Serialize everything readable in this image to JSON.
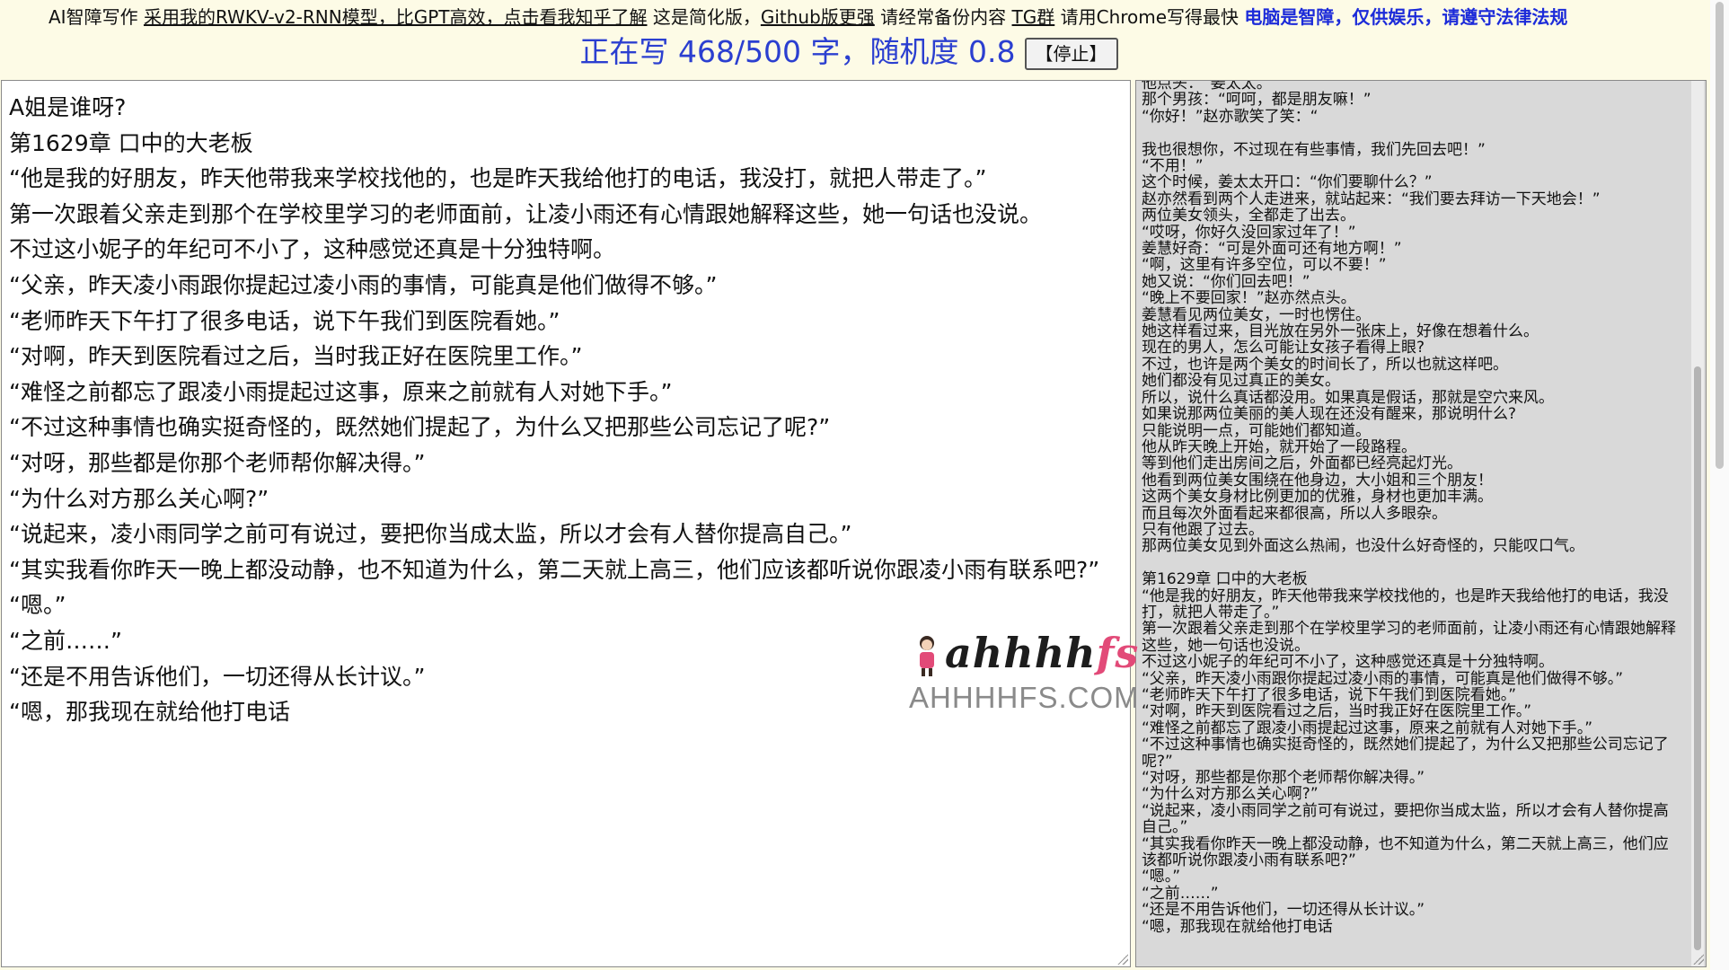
{
  "header": {
    "app_name": "AI智障写作",
    "model_link": "采用我的RWKV-v2-RNN模型，比GPT高效，点击看我知乎了解",
    "simplified_note": "这是简化版，",
    "github_link": "Github版更强",
    "backup_note": "请经常备份内容",
    "tg_link": "TG群",
    "chrome_note": "请用Chrome写得最快",
    "warning": "电脑是智障，仅供娱乐，请遵守法律法规",
    "status": "正在写 468/500 字，随机度 0.8",
    "stop_button": "【停止】",
    "colors": {
      "warning": "#1c2bd9",
      "status": "#2b3fd0"
    }
  },
  "editor": {
    "paragraphs": [
      "A姐是谁呀?",
      "第1629章 口中的大老板",
      "“他是我的好朋友，昨天他带我来学校找他的，也是昨天我给他打的电话，我没打，就把人带走了。”",
      "第一次跟着父亲走到那个在学校里学习的老师面前，让凌小雨还有心情跟她解释这些，她一句话也没说。",
      "不过这小妮子的年纪可不小了，这种感觉还真是十分独特啊。",
      "“父亲，昨天凌小雨跟你提起过凌小雨的事情，可能真是他们做得不够。”",
      "“老师昨天下午打了很多电话，说下午我们到医院看她。”",
      "“对啊，昨天到医院看过之后，当时我正好在医院里工作。”",
      "“难怪之前都忘了跟凌小雨提起过这事，原来之前就有人对她下手。”",
      "“不过这种事情也确实挺奇怪的，既然她们提起了，为什么又把那些公司忘记了呢?”",
      "“对呀，那些都是你那个老师帮你解决得。”",
      "“为什么对方那么关心啊?”",
      "“说起来，凌小雨同学之前可有说过，要把你当成太监，所以才会有人替你提高自己。”",
      "“其实我看你昨天一晚上都没动静，也不知道为什么，第二天就上高三，他们应该都听说你跟凌小雨有联系吧?”",
      "“嗯。”",
      "“之前……”",
      "“还是不用告诉他们，一切还得从长计议。”",
      "“嗯，那我现在就给他打电话"
    ]
  },
  "side": {
    "lines": [
      "他点头：“姜太太。”",
      "那个男孩：“呵呵，都是朋友嘛！”",
      "“你好！”赵亦歌笑了笑：“",
      "",
      "我也很想你，不过现在有些事情，我们先回去吧！”",
      "“不用！”",
      "这个时候，姜太太开口：“你们要聊什么？”",
      "赵亦然看到两个人走进来，就站起来：“我们要去拜访一下天地会！”",
      "两位美女领头，全都走了出去。",
      "“哎呀，你好久没回家过年了！”",
      "姜慧好奇：“可是外面可还有地方啊！”",
      "“啊，这里有许多空位，可以不要！”",
      "她又说：“你们回去吧！”",
      "“晚上不要回家！”赵亦然点头。",
      "姜慧看见两位美女，一时也愣住。",
      "她这样看过来，目光放在另外一张床上，好像在想着什么。",
      "现在的男人，怎么可能让女孩子看得上眼?",
      "不过，也许是两个美女的时间长了，所以也就这样吧。",
      "她们都没有见过真正的美女。",
      "所以，说什么真话都没用。如果真是假话，那就是空穴来风。",
      "如果说那两位美丽的美人现在还没有醒来，那说明什么?",
      "只能说明一点，可能她们都知道。",
      "他从昨天晚上开始，就开始了一段路程。",
      "等到他们走出房间之后，外面都已经亮起灯光。",
      "他看到两位美女围绕在他身边，大小姐和三个朋友！",
      "这两个美女身材比例更加的优雅，身材也更加丰满。",
      "而且每次外面看起来都很高，所以人多眼杂。",
      "只有他跟了过去。",
      "那两位美女见到外面这么热闹，也没什么好奇怪的，只能叹口气。",
      "",
      "第1629章 口中的大老板",
      "“他是我的好朋友，昨天他带我来学校找他的，也是昨天我给他打的电话，我没打，就把人带走了。”",
      "第一次跟着父亲走到那个在学校里学习的老师面前，让凌小雨还有心情跟她解释这些，她一句话也没说。",
      "不过这小妮子的年纪可不小了，这种感觉还真是十分独特啊。",
      "“父亲，昨天凌小雨跟你提起过凌小雨的事情，可能真是他们做得不够。”",
      "“老师昨天下午打了很多电话，说下午我们到医院看她。”",
      "“对啊，昨天到医院看过之后，当时我正好在医院里工作。”",
      "“难怪之前都忘了跟凌小雨提起过这事，原来之前就有人对她下手。”",
      "“不过这种事情也确实挺奇怪的，既然她们提起了，为什么又把那些公司忘记了呢?”",
      "“对呀，那些都是你那个老师帮你解决得。”",
      "“为什么对方那么关心啊?”",
      "“说起来，凌小雨同学之前可有说过，要把你当成太监，所以才会有人替你提高自己。”",
      "“其实我看你昨天一晚上都没动静，也不知道为什么，第二天就上高三，他们应该都听说你跟凌小雨有联系吧?”",
      "“嗯。”",
      "“之前……”",
      "“还是不用告诉他们，一切还得从长计议。”",
      "“嗯，那我现在就给他打电话"
    ]
  },
  "watermark": {
    "script_text": "ahhhhfs",
    "domain_text": "AHHHHFS.COM"
  }
}
